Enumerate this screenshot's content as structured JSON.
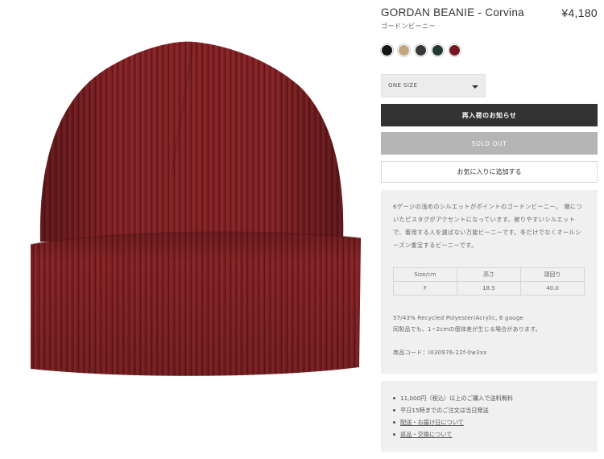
{
  "product": {
    "title": "GORDAN BEANIE - Corvina",
    "price": "¥4,180",
    "subtitle": "ゴードンビーニー",
    "image_icon": "beanie-product-image"
  },
  "swatches": [
    {
      "color": "#151515"
    },
    {
      "color": "#c2a57f"
    },
    {
      "color": "#383838"
    },
    {
      "color": "#24392f"
    },
    {
      "color": "#75171e"
    }
  ],
  "size_select": {
    "value": "ONE SIZE",
    "icon": "caret-down-icon"
  },
  "buttons": {
    "notify": "再入荷のお知らせ",
    "soldout": "SOLD OUT",
    "favorite": "お気に入りに追加する"
  },
  "description": {
    "text": "6ゲージの浅めのシルエットがポイントのゴードンビーニー。 端についたピスタグがアクセントになっています。被りやすいシルエットで、着用する人を選ばない万能ビーニーです。冬だけでなくオールシーズン重宝するビーニーです。",
    "size_table": {
      "headers": [
        "Size/cm",
        "高さ",
        "頭回り"
      ],
      "row": [
        "F",
        "18.5",
        "40.0"
      ]
    },
    "material_line1": "57/43% Recycled Polyester/Acrylic, 6 gauge",
    "material_line2": "同製品でも、1~2cmの個体差が生じる場合があります。",
    "product_code": "商品コード：I030976-22f-0w3xx"
  },
  "info": {
    "items": [
      "11,000円（税込）以上のご購入で送料無料",
      "平日15時までのご注文は当日発送",
      "配送・お届け日について",
      "返品・交換について"
    ]
  }
}
